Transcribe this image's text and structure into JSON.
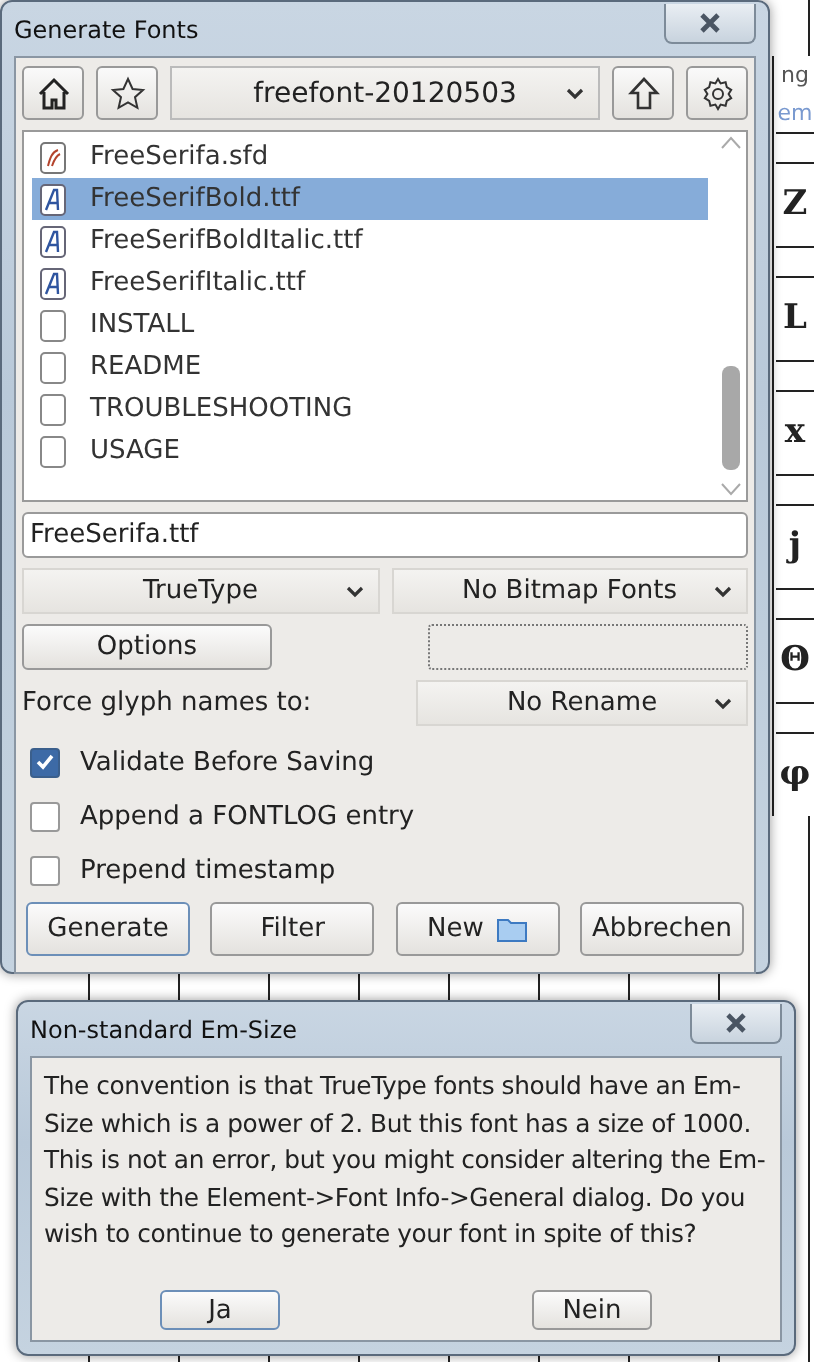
{
  "background": {
    "header_texts": [
      "ng",
      "em"
    ],
    "glyphs": [
      "Z",
      "L",
      "x",
      "j",
      "Θ",
      "φ"
    ]
  },
  "generate_dialog": {
    "title": "Generate Fonts",
    "path": "freefont-20120503",
    "files": [
      {
        "name": "FreeSerifa.sfd",
        "kind": "sfd",
        "selected": false
      },
      {
        "name": "FreeSerifBold.ttf",
        "kind": "ttf",
        "selected": true
      },
      {
        "name": "FreeSerifBoldItalic.ttf",
        "kind": "ttf",
        "selected": false
      },
      {
        "name": "FreeSerifItalic.ttf",
        "kind": "ttf",
        "selected": false
      },
      {
        "name": "INSTALL",
        "kind": "file",
        "selected": false
      },
      {
        "name": "README",
        "kind": "file",
        "selected": false
      },
      {
        "name": "TROUBLESHOOTING",
        "kind": "file",
        "selected": false
      },
      {
        "name": "USAGE",
        "kind": "file",
        "selected": false
      }
    ],
    "filename": "FreeSerifa.ttf",
    "format": "TrueType",
    "bitmaps": "No Bitmap Fonts",
    "options_button": "Options",
    "force_glyph_label": "Force glyph names to:",
    "rename": "No Rename",
    "checkboxes": [
      {
        "label": "Validate Before Saving",
        "checked": true
      },
      {
        "label": "Append a FONTLOG entry",
        "checked": false
      },
      {
        "label": "Prepend timestamp",
        "checked": false
      }
    ],
    "buttons": [
      {
        "label": "Generate",
        "kind": "default"
      },
      {
        "label": "Filter",
        "kind": "plain"
      },
      {
        "label": "New",
        "kind": "folder"
      },
      {
        "label": "Abbrechen",
        "kind": "plain"
      }
    ]
  },
  "alert": {
    "title": "Non-standard Em-Size",
    "message": "The convention is that TrueType fonts should have an Em-Size which is a power of 2. But this font has a size of 1000. This is not an error, but you might consider altering the Em-Size with the Element->Font Info->General dialog. Do you wish to continue to generate your font in spite of this?",
    "buttons": [
      {
        "label": "Ja",
        "kind": "default"
      },
      {
        "label": "Nein",
        "kind": "plain"
      }
    ]
  }
}
